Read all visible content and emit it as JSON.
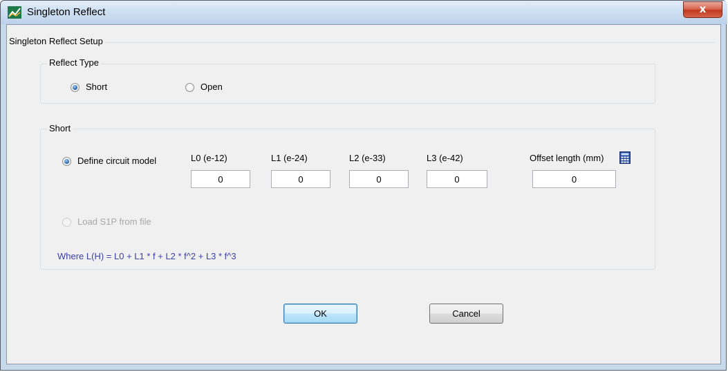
{
  "window": {
    "title": "Singleton Reflect",
    "close_label": "x"
  },
  "setup": {
    "legend": "Singleton Reflect Setup"
  },
  "reflect_type": {
    "legend": "Reflect Type",
    "options": [
      {
        "label": "Short",
        "checked": true
      },
      {
        "label": "Open",
        "checked": false
      }
    ]
  },
  "short": {
    "legend": "Short",
    "define_circuit_model": {
      "label": "Define circuit model",
      "checked": true
    },
    "load_s1p": {
      "label": "Load S1P from file",
      "checked": false,
      "disabled": true
    },
    "fields": {
      "l0": {
        "label": "L0 (e-12)",
        "value": "0"
      },
      "l1": {
        "label": "L1 (e-24)",
        "value": "0"
      },
      "l2": {
        "label": "L2 (e-33)",
        "value": "0"
      },
      "l3": {
        "label": "L3 (e-42)",
        "value": "0"
      },
      "offset": {
        "label": "Offset length (mm)",
        "value": "0"
      }
    },
    "formula": "Where L(H) = L0 + L1 * f + L2 * f^2 + L3 * f^3"
  },
  "buttons": {
    "ok": "OK",
    "cancel": "Cancel"
  },
  "icons": {
    "app": "app-icon",
    "calculator": "calculator-icon",
    "close": "close-icon"
  },
  "colors": {
    "formula_text": "#3a3fa8",
    "title_bar": "#cfe0f3",
    "close_button": "#c0391f"
  }
}
